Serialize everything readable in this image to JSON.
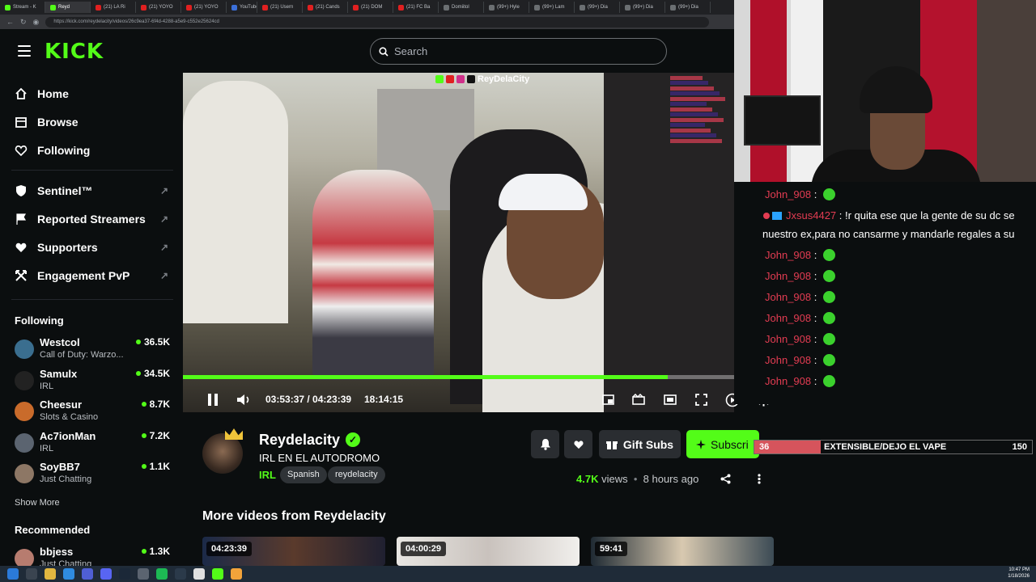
{
  "browser": {
    "tabs": [
      "Stream - K",
      "Reyd",
      "(21) LA Ri",
      "(21) YOYO",
      "(21) YOYO",
      "YouTube",
      "(21) Usern",
      "(21) Cands",
      "(21) DOM",
      "(21) FC Ba",
      "Domiitol",
      "(99+) Hyle",
      "(99+) Lam",
      "(99+) Dia",
      "(99+) Dia",
      "(99+) Dia"
    ],
    "url": "https://kick.com/reydelacity/videos/26c9ea37-6f4d-4288-a5e9-c552e25624cd"
  },
  "header": {
    "logo": "KICK",
    "search_placeholder": "Search"
  },
  "sidebar": {
    "nav": [
      {
        "label": "Home",
        "icon": "home-icon"
      },
      {
        "label": "Browse",
        "icon": "browse-icon"
      },
      {
        "label": "Following",
        "icon": "heart-icon"
      }
    ],
    "tools": [
      {
        "label": "Sentinel™",
        "icon": "shield-icon"
      },
      {
        "label": "Reported Streamers",
        "icon": "flag-icon"
      },
      {
        "label": "Supporters",
        "icon": "heart-icon"
      },
      {
        "label": "Engagement PvP",
        "icon": "engagement-icon"
      }
    ],
    "following_title": "Following",
    "following": [
      {
        "name": "Westcol",
        "game": "Call of Duty: Warzo...",
        "viewers": "36.5K",
        "color": "#3a6e8f"
      },
      {
        "name": "Samulx",
        "game": "IRL",
        "viewers": "34.5K",
        "color": "#222222"
      },
      {
        "name": "Cheesur",
        "game": "Slots & Casino",
        "viewers": "8.7K",
        "color": "#c96b2b"
      },
      {
        "name": "Ac7ionMan",
        "game": "IRL",
        "viewers": "7.2K",
        "color": "#5b6470"
      },
      {
        "name": "SoyBB7",
        "game": "Just Chatting",
        "viewers": "1.1K",
        "color": "#8d7765"
      }
    ],
    "show_more": "Show More",
    "recommended_title": "Recommended",
    "recommended": [
      {
        "name": "bbjess",
        "game": "Just Chatting",
        "viewers": "1.3K",
        "color": "#b77c6f"
      }
    ]
  },
  "player": {
    "elapsed": "03:53:37 / 04:23:39",
    "clock": "18:14:15",
    "progress": 0.88,
    "watermark": "ReyDelaCity"
  },
  "stream": {
    "streamer": "Reydelacity",
    "title": "IRL EN EL AUTODROMO",
    "category": "IRL",
    "tags": [
      "Spanish",
      "reydelacity"
    ],
    "gift_label": "Gift Subs",
    "subscribe_label": "Subscri",
    "views_count": "4.7K",
    "views_word": "views",
    "ago": "8 hours ago",
    "more_videos": "More videos from Reydelacity",
    "thumbnails": [
      {
        "duration": "04:23:39"
      },
      {
        "duration": "04:00:29"
      },
      {
        "duration": "59:41"
      }
    ]
  },
  "chat": {
    "messages": [
      {
        "user": "John_908",
        "text": ""
      },
      {
        "user": "Jxsus4427",
        "text": "!r quita ese que la gente de su dc se",
        "cont": "nuestro ex,para no cansarme y mandarle regales a su"
      },
      {
        "user": "John_908",
        "text": ""
      },
      {
        "user": "John_908",
        "text": ""
      },
      {
        "user": "John_908",
        "text": ""
      },
      {
        "user": "John_908",
        "text": ""
      },
      {
        "user": "John_908",
        "text": ""
      },
      {
        "user": "John_908",
        "text": ""
      },
      {
        "user": "John_908",
        "text": ""
      }
    ]
  },
  "goal": {
    "current": "36",
    "label": "EXTENSIBLE/DEJO EL VAPE",
    "target": "150",
    "fraction": 0.24
  },
  "taskbar": {
    "time": "10:47 PM",
    "date": "1/18/2026"
  }
}
